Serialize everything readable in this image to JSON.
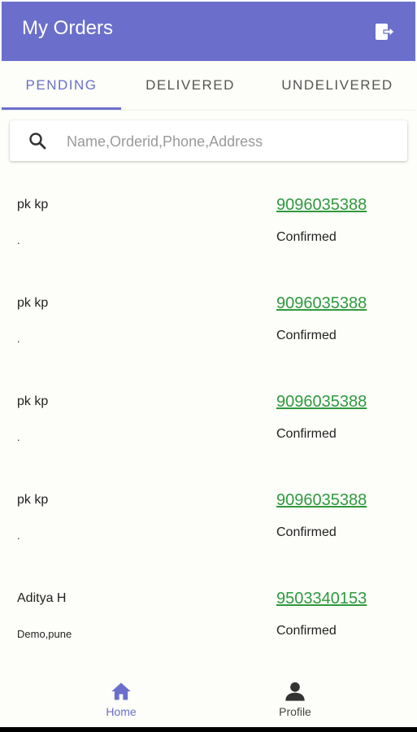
{
  "app": {
    "title": "My Orders",
    "accent_color": "#6b6fcb",
    "logout_icon": "logout-icon"
  },
  "tabs": [
    {
      "label": "PENDING",
      "active": true
    },
    {
      "label": "DELIVERED",
      "active": false
    },
    {
      "label": "UNDELIVERED",
      "active": false
    }
  ],
  "search": {
    "placeholder": "Name,Orderid,Phone,Address",
    "value": "",
    "icon": "search-icon"
  },
  "orders": [
    {
      "name": "pk kp",
      "address": ".",
      "phone": "9096035388",
      "status": "Confirmed"
    },
    {
      "name": "pk kp",
      "address": ".",
      "phone": "9096035388",
      "status": "Confirmed"
    },
    {
      "name": "pk kp",
      "address": ".",
      "phone": "9096035388",
      "status": "Confirmed"
    },
    {
      "name": "pk kp",
      "address": ".",
      "phone": "9096035388",
      "status": "Confirmed"
    },
    {
      "name": "Aditya H",
      "address": "Demo,pune",
      "phone": "9503340153",
      "status": "Confirmed"
    }
  ],
  "phone_color": "#2e9a3e",
  "bottom_nav": {
    "items": [
      {
        "label": "Home",
        "icon": "home-icon",
        "active": true
      },
      {
        "label": "Profile",
        "icon": "person-icon",
        "active": false
      }
    ]
  }
}
